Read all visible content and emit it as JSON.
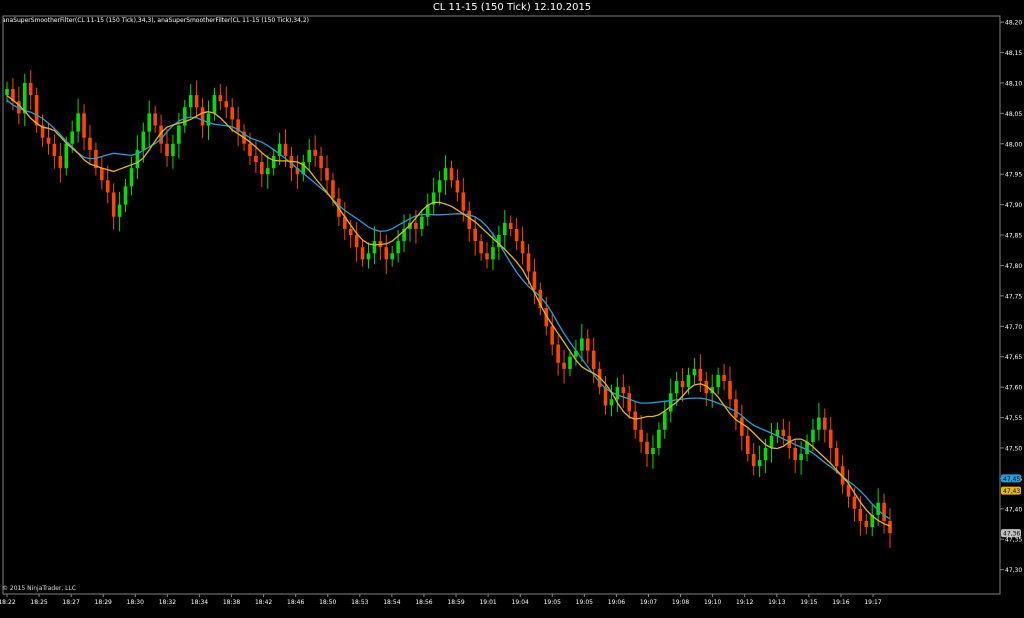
{
  "window": {
    "title": "CL 11-15 (150 Tick)  12.10.2015"
  },
  "indicators_label": "anaSuperSmootherFilter(CL 11-15 (150 Tick),34,3), anaSuperSmootherFilter(CL 11-15 (150 Tick),34,2)",
  "copyright": "© 2015 NinjaTrader, LLC",
  "colors": {
    "up": "#00e000",
    "down": "#ff4500",
    "doji": "#ffffff",
    "line_blue": "#1ea0e0",
    "line_gold": "#e8b800",
    "frame": "#808080"
  },
  "chart_data": {
    "type": "candlestick",
    "instrument": "CL 11-15",
    "interval": "150 Tick",
    "date": "12.10.2015",
    "ylim": [
      47.26,
      48.21
    ],
    "y_ticks": [
      "48,20",
      "48,15",
      "48,10",
      "48,05",
      "48,00",
      "47,95",
      "47,90",
      "47,85",
      "47,80",
      "47,75",
      "47,70",
      "47,65",
      "47,60",
      "47,55",
      "47,50",
      "47,45",
      "47,40",
      "47,35",
      "47,30"
    ],
    "x_ticks": [
      "18:22",
      "18:25",
      "18:27",
      "18:29",
      "18:30",
      "18:32",
      "18:34",
      "18:38",
      "18:42",
      "18:46",
      "18:50",
      "18:53",
      "18:54",
      "18:56",
      "18:59",
      "19:01",
      "19:04",
      "19:05",
      "19:05",
      "19:06",
      "19:07",
      "19:08",
      "19:10",
      "19:12",
      "19:13",
      "19:15",
      "19:16",
      "19:17"
    ],
    "price_markers": [
      {
        "label": "47,45",
        "value": 47.45,
        "color": "#1ea0e0"
      },
      {
        "label": "47,43",
        "value": 47.43,
        "color": "#e8b800"
      },
      {
        "label": "47,36",
        "value": 47.36,
        "color": "#c0c0c0"
      }
    ],
    "closes": [
      48.09,
      48.07,
      48.05,
      48.1,
      48.08,
      48.03,
      48.01,
      48.0,
      47.98,
      47.96,
      48.0,
      48.02,
      48.05,
      48.01,
      47.99,
      47.96,
      47.94,
      47.92,
      47.88,
      47.9,
      47.93,
      47.96,
      47.99,
      48.02,
      48.05,
      48.03,
      48.0,
      47.98,
      48.0,
      48.03,
      48.06,
      48.08,
      48.06,
      48.03,
      48.05,
      48.08,
      48.07,
      48.06,
      48.04,
      48.02,
      48.0,
      47.98,
      47.97,
      47.95,
      47.96,
      47.98,
      48.0,
      47.98,
      47.96,
      47.95,
      47.97,
      47.99,
      47.98,
      47.96,
      47.94,
      47.91,
      47.88,
      47.86,
      47.85,
      47.83,
      47.81,
      47.82,
      47.84,
      47.83,
      47.81,
      47.82,
      47.84,
      47.86,
      47.87,
      47.86,
      47.88,
      47.9,
      47.92,
      47.94,
      47.96,
      47.94,
      47.92,
      47.89,
      47.86,
      47.84,
      47.82,
      47.81,
      47.83,
      47.85,
      47.87,
      47.86,
      47.84,
      47.82,
      47.79,
      47.76,
      47.73,
      47.7,
      47.67,
      47.64,
      47.63,
      47.65,
      47.66,
      47.68,
      47.66,
      47.63,
      47.6,
      47.57,
      47.58,
      47.6,
      47.59,
      47.56,
      47.53,
      47.51,
      47.49,
      47.5,
      47.53,
      47.56,
      47.59,
      47.61,
      47.6,
      47.62,
      47.63,
      47.61,
      47.59,
      47.6,
      47.62,
      47.61,
      47.58,
      47.55,
      47.52,
      47.49,
      47.47,
      47.48,
      47.5,
      47.52,
      47.53,
      47.52,
      47.5,
      47.48,
      47.49,
      47.51,
      47.53,
      47.55,
      47.53,
      47.5,
      47.47,
      47.44,
      47.42,
      47.4,
      47.38,
      47.37,
      47.39,
      47.41,
      47.38,
      47.36
    ]
  }
}
